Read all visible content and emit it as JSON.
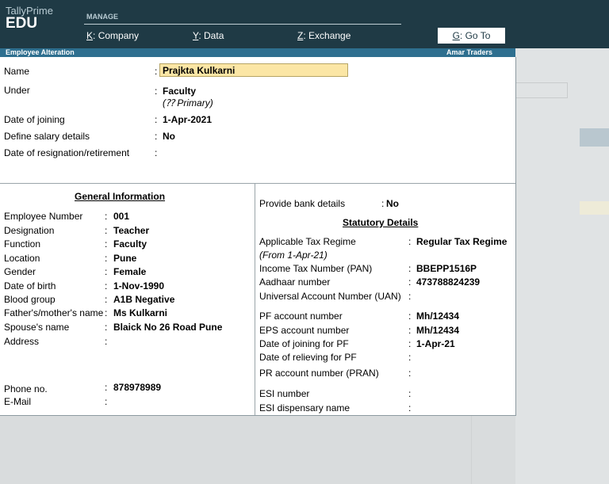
{
  "brand": {
    "name": "TallyPrime",
    "edition": "EDU"
  },
  "menu": {
    "section": "MANAGE",
    "items": [
      {
        "key": "K",
        "label": "Company"
      },
      {
        "key": "Y",
        "label": "Data"
      },
      {
        "key": "Z",
        "label": "Exchange"
      }
    ],
    "goto": {
      "key": "G",
      "label": "Go To"
    }
  },
  "titlebar": {
    "screen": "Employee  Alteration",
    "company": "Amar Traders"
  },
  "colors": {
    "topbar": "#1f3a45",
    "titlebar": "#2e6f8f",
    "name_field": "#fbe6a5",
    "accent_strip": "#b9c7cf",
    "highlight_strip": "#eeebd8"
  },
  "form": {
    "name": {
      "label": "Name",
      "value": "Prajkta Kulkarni"
    },
    "under": {
      "label": "Under",
      "value": "Faculty",
      "sub": "(⁇ Primary)"
    },
    "doj": {
      "label": "Date of joining",
      "value": "1-Apr-2021"
    },
    "salary": {
      "label": "Define salary details",
      "value": "No"
    },
    "resign": {
      "label": "Date of resignation/retirement",
      "value": ""
    }
  },
  "general": {
    "title": "General Information",
    "rows": [
      {
        "label": "Employee Number",
        "value": "001"
      },
      {
        "label": "Designation",
        "value": "Teacher"
      },
      {
        "label": "Function",
        "value": "Faculty"
      },
      {
        "label": "Location",
        "value": "Pune"
      },
      {
        "label": "Gender",
        "value": "Female"
      },
      {
        "label": "Date of birth",
        "value": "1-Nov-1990"
      },
      {
        "label": "Blood group",
        "value": "A1B Negative"
      },
      {
        "label": "Father's/mother's name",
        "value": "Ms Kulkarni"
      },
      {
        "label": "Spouse's name",
        "value": "Blaick No 26 Road Pune"
      },
      {
        "label": "Address",
        "value": ""
      }
    ],
    "phone": {
      "label": "Phone no.",
      "value": "878978989"
    },
    "email": {
      "label": "E-Mail",
      "value": ""
    }
  },
  "right": {
    "bank": {
      "label": "Provide bank details",
      "value": "No"
    },
    "statutory_title": "Statutory Details",
    "tax_regime": {
      "label": "Applicable Tax Regime",
      "value": "Regular Tax Regime",
      "sub": "(From 1-Apr-21)"
    },
    "pan": {
      "label": "Income Tax Number (PAN)",
      "value": "BBEPP1516P"
    },
    "aadhaar": {
      "label": "Aadhaar number",
      "value": "473788824239"
    },
    "uan": {
      "label": "Universal Account Number (UAN)",
      "value": ""
    },
    "pf": {
      "label": "PF account number",
      "value": "Mh/12434"
    },
    "eps": {
      "label": "EPS account number",
      "value": "Mh/12434"
    },
    "pf_join": {
      "label": "Date of joining for PF",
      "value": "1-Apr-21"
    },
    "pf_relieve": {
      "label": "Date of relieving for PF",
      "value": ""
    },
    "pran": {
      "label": "PR account number (PRAN)",
      "value": ""
    },
    "esi": {
      "label": "ESI number",
      "value": ""
    },
    "esi_disp": {
      "label": "ESI dispensary name",
      "value": ""
    }
  }
}
